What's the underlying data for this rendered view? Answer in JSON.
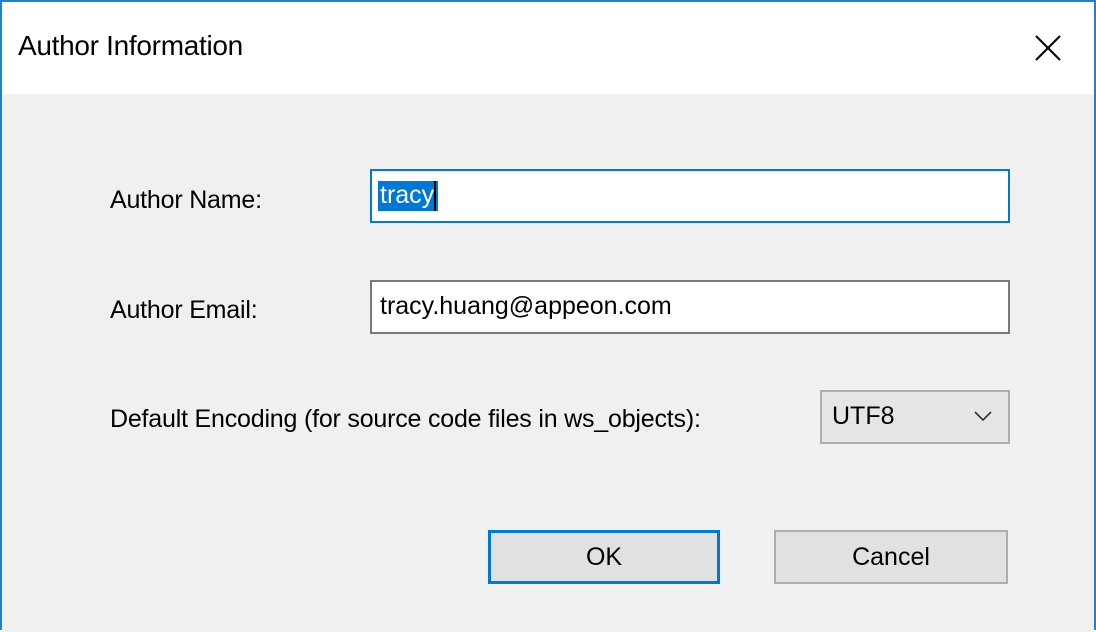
{
  "window": {
    "title": "Author Information"
  },
  "form": {
    "author_name_label": "Author Name:",
    "author_name_value": "tracy",
    "author_email_label": "Author Email:",
    "author_email_value": "tracy.huang@appeon.com",
    "encoding_label": "Default Encoding (for source code files in ws_objects):",
    "encoding_selected": "UTF8"
  },
  "buttons": {
    "ok_label": "OK",
    "cancel_label": "Cancel"
  },
  "icons": {
    "close": "close-icon",
    "dropdown": "chevron-down-icon"
  },
  "colors": {
    "accent": "#0078d7",
    "window_border": "#1883d7",
    "dialog_bg": "#f0f0f0"
  }
}
